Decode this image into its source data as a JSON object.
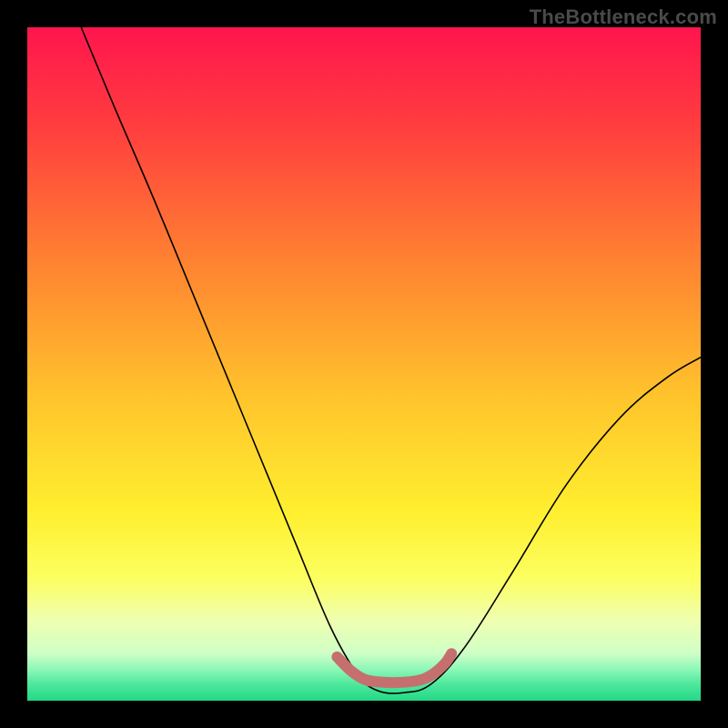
{
  "watermark": "TheBottleneck.com",
  "chart_data": {
    "type": "line",
    "title": "",
    "xlabel": "",
    "ylabel": "",
    "xlim": [
      0,
      100
    ],
    "ylim": [
      0,
      100
    ],
    "background_gradient": {
      "stops": [
        {
          "offset": 0.0,
          "color": "#ff154e"
        },
        {
          "offset": 0.15,
          "color": "#ff3e3e"
        },
        {
          "offset": 0.35,
          "color": "#ff8331"
        },
        {
          "offset": 0.55,
          "color": "#ffc42c"
        },
        {
          "offset": 0.72,
          "color": "#ffef2f"
        },
        {
          "offset": 0.82,
          "color": "#fcff61"
        },
        {
          "offset": 0.88,
          "color": "#efffb0"
        },
        {
          "offset": 0.93,
          "color": "#cfffc6"
        },
        {
          "offset": 0.955,
          "color": "#88f7b6"
        },
        {
          "offset": 0.975,
          "color": "#4fe89d"
        },
        {
          "offset": 1.0,
          "color": "#22d886"
        }
      ]
    },
    "series": [
      {
        "name": "bottleneck-curve",
        "stroke": "#000000",
        "stroke_width": 1.6,
        "points": [
          {
            "x": 8,
            "y": 100
          },
          {
            "x": 13,
            "y": 88
          },
          {
            "x": 19,
            "y": 74
          },
          {
            "x": 26,
            "y": 57
          },
          {
            "x": 33,
            "y": 40
          },
          {
            "x": 40,
            "y": 23
          },
          {
            "x": 45,
            "y": 11
          },
          {
            "x": 49,
            "y": 4
          },
          {
            "x": 52,
            "y": 1.5
          },
          {
            "x": 56,
            "y": 1.2
          },
          {
            "x": 60,
            "y": 2.5
          },
          {
            "x": 65,
            "y": 8
          },
          {
            "x": 72,
            "y": 19
          },
          {
            "x": 80,
            "y": 32
          },
          {
            "x": 88,
            "y": 42
          },
          {
            "x": 95,
            "y": 48
          },
          {
            "x": 100,
            "y": 51
          }
        ]
      },
      {
        "name": "optimal-band-marker",
        "stroke": "#c5706f",
        "stroke_width": 12,
        "linecap": "round",
        "points": [
          {
            "x": 46,
            "y": 6.5
          },
          {
            "x": 48,
            "y": 4.5
          },
          {
            "x": 50,
            "y": 3.2
          },
          {
            "x": 52,
            "y": 2.8
          },
          {
            "x": 55,
            "y": 2.7
          },
          {
            "x": 58,
            "y": 3.0
          },
          {
            "x": 60,
            "y": 3.8
          },
          {
            "x": 62,
            "y": 5.5
          },
          {
            "x": 63,
            "y": 7.0
          }
        ]
      }
    ]
  }
}
